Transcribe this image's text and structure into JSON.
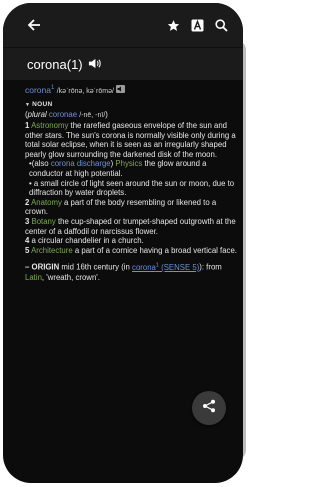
{
  "headword": "corona(1)",
  "entry": {
    "word": "corona",
    "word_sup": "1",
    "pronunciation": "/kəˈrōnə, kəˈrōmə/",
    "pos": "NOUN",
    "plural_label": "plural",
    "plural_form": "coronae",
    "plural_pron": "/-nē, -nī/",
    "senses": [
      {
        "num": "1",
        "field": "Astronomy",
        "text": " the rarefied gaseous envelope of the sun and other stars. The sun's corona is normally visible only during a total solar eclipse, when it is seen as an irregularly shaped pearly glow surrounding the darkened disk of the moon."
      },
      {
        "num": "2",
        "field": "Anatomy",
        "text": " a part of the body resembling or likened to a crown."
      },
      {
        "num": "3",
        "field": "Botany",
        "text": " the cup-shaped or trumpet-shaped outgrowth at the center of a daffodil or narcissus flower."
      },
      {
        "num": "4",
        "field": "",
        "text": " a circular chandelier in a church."
      },
      {
        "num": "5",
        "field": "Architecture",
        "text": " a part of a cornice having a broad vertical face."
      }
    ],
    "sub1_prefix": "(also ",
    "sub1_link": "corona discharge",
    "sub1_suffix": ") ",
    "sub1_field": "Physics",
    "sub1_text": " the glow around a conductor at high potential.",
    "sub2_text": "a small circle of light seen around the sun or moon, due to diffraction by water droplets.",
    "origin_label": "– ORIGIN",
    "origin_text_1": " mid 16th century (in ",
    "origin_link_word": "corona",
    "origin_link_sup": "1",
    "origin_link_sense": " (SENSE 5)",
    "origin_text_2": "): from ",
    "origin_lang": "Latin",
    "origin_text_3": ", 'wreath, crown'."
  },
  "icons": {
    "back": "arrow-left-icon",
    "favorite": "star-icon",
    "font": "font-size-icon",
    "search": "search-icon",
    "speaker": "speaker-icon",
    "share": "share-icon"
  },
  "colors": {
    "link": "#6f8fd9",
    "field": "#7fa85a",
    "background": "#0c0c0c",
    "appbar": "#1b1b1b"
  }
}
